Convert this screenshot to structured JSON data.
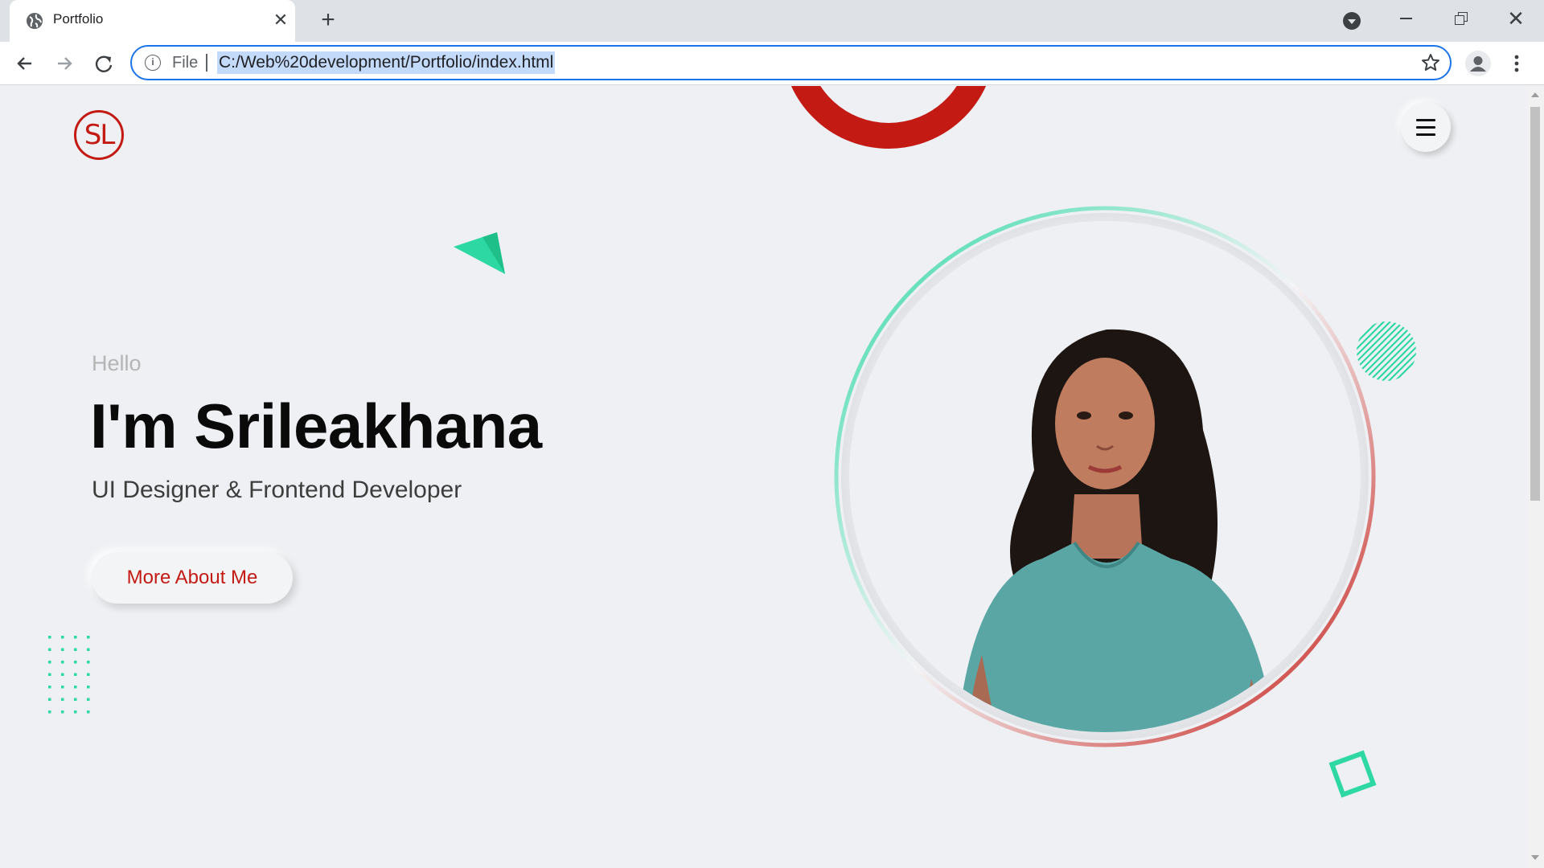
{
  "browser": {
    "tab_title": "Portfolio",
    "new_tab_symbol": "+",
    "close_symbol": "✕",
    "url_scheme_label": "File",
    "url": "C:/Web%20development/Portfolio/index.html",
    "colors": {
      "tabstrip": "#dee1e6",
      "focus_ring": "#1a73e8",
      "selection": "#c4dafa"
    }
  },
  "site": {
    "logo_text": "SL",
    "hero": {
      "greeting": "Hello",
      "name": "I'm Srileakhana",
      "role": "UI Designer & Frontend Developer",
      "cta_label": "More About Me"
    },
    "colors": {
      "accent_red": "#c31a14",
      "accent_green": "#2ed8a2",
      "background": "#eef0f3"
    },
    "decorations": [
      "red-ring",
      "green-triangle",
      "green-striped-circle",
      "green-dot-grid",
      "green-square-outline"
    ],
    "portrait_alt": "portrait-photo"
  }
}
